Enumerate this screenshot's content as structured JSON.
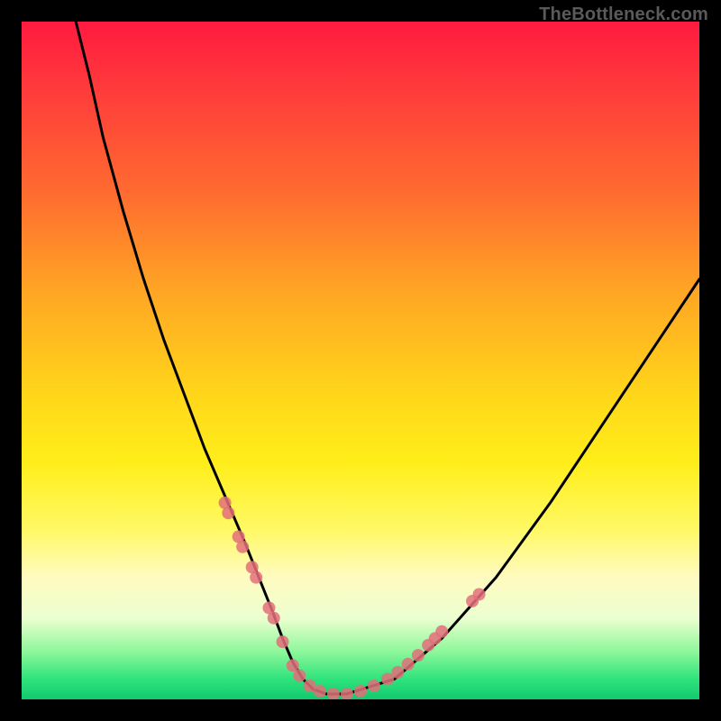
{
  "watermark": "TheBottleneck.com",
  "colors": {
    "background": "#000000",
    "curve": "#000000",
    "marker": "#e36f7a",
    "gradient_top": "#ff1a40",
    "gradient_bottom": "#12c96e"
  },
  "chart_data": {
    "type": "line",
    "title": "",
    "xlabel": "",
    "ylabel": "",
    "xlim": [
      0,
      100
    ],
    "ylim": [
      0,
      100
    ],
    "note": "Unlabeled bottleneck curve; values are percent positions read from the figure (x: 0=left edge of plot, y: 0=bottom; points estimated from pixels).",
    "series": [
      {
        "name": "curve",
        "kind": "path",
        "x": [
          8,
          10,
          12,
          15,
          18,
          21,
          24,
          27,
          30,
          33,
          35,
          37,
          38.5,
          40,
          41.5,
          43,
          45,
          48,
          55,
          62,
          70,
          78,
          86,
          94,
          100
        ],
        "y": [
          100,
          92,
          83,
          72,
          62,
          53,
          45,
          37,
          30,
          23,
          18,
          13,
          9,
          5.5,
          3,
          1.5,
          0.8,
          0.8,
          3,
          9,
          18,
          29,
          41,
          53,
          62
        ]
      },
      {
        "name": "markers_left",
        "kind": "scatter",
        "x": [
          30,
          30.5,
          32,
          32.6,
          34,
          34.6,
          36.5,
          37.2,
          38.5
        ],
        "y": [
          29,
          27.5,
          24,
          22.5,
          19.5,
          18,
          13.5,
          12,
          8.5
        ]
      },
      {
        "name": "markers_bottom",
        "kind": "scatter",
        "x": [
          40,
          41,
          42.5,
          44,
          46,
          48,
          50
        ],
        "y": [
          5,
          3.5,
          2,
          1.2,
          0.8,
          0.8,
          1.2
        ]
      },
      {
        "name": "markers_right",
        "kind": "scatter",
        "x": [
          52,
          54,
          55.5,
          57,
          58.5,
          60,
          61,
          62,
          66.5,
          67.5
        ],
        "y": [
          2,
          3,
          4,
          5.2,
          6.5,
          8,
          9,
          10,
          14.5,
          15.5
        ]
      }
    ]
  }
}
